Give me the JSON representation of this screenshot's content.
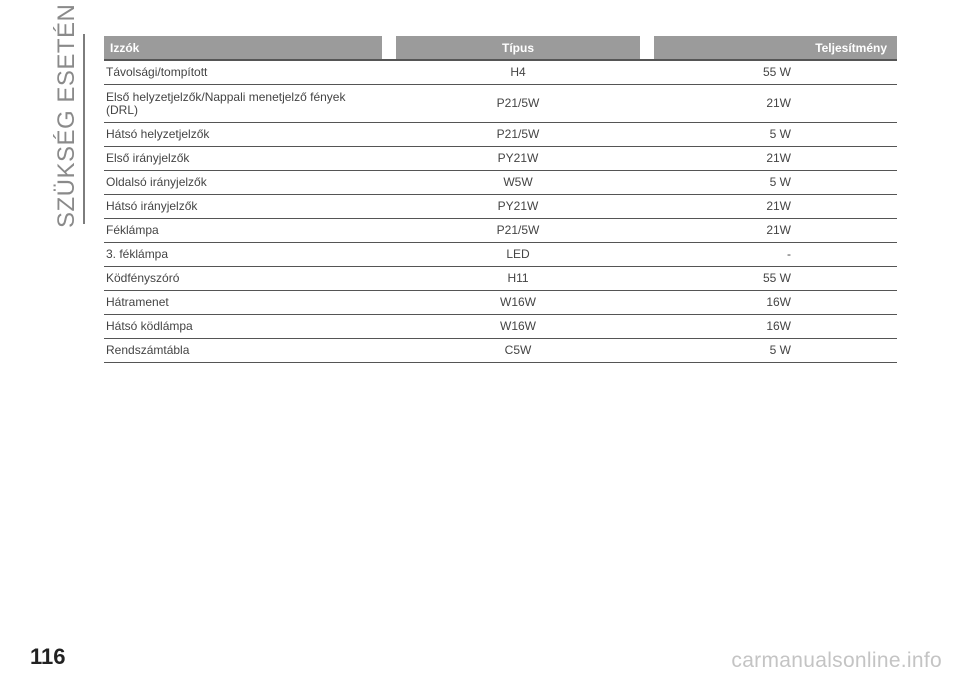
{
  "section": {
    "title": "SZÜKSÉG ESETÉN"
  },
  "table": {
    "headers": {
      "name": "Izzók",
      "type": "Típus",
      "power": "Teljesítmény"
    },
    "rows": [
      {
        "name": "Távolsági/tompított",
        "type": "H4",
        "power": "55 W"
      },
      {
        "name": "Első helyzetjelzők/Nappali menetjelző fények (DRL)",
        "type": "P21/5W",
        "power": "21W"
      },
      {
        "name": "Hátsó helyzetjelzők",
        "type": "P21/5W",
        "power": "5 W"
      },
      {
        "name": "Első irányjelzők",
        "type": "PY21W",
        "power": "21W"
      },
      {
        "name": "Oldalsó irányjelzők",
        "type": "W5W",
        "power": "5 W"
      },
      {
        "name": "Hátsó irányjelzők",
        "type": "PY21W",
        "power": "21W"
      },
      {
        "name": "Féklámpa",
        "type": "P21/5W",
        "power": "21W"
      },
      {
        "name": "3. féklámpa",
        "type": "LED",
        "power": "-"
      },
      {
        "name": "Ködfényszóró",
        "type": "H11",
        "power": "55 W"
      },
      {
        "name": "Hátramenet",
        "type": "W16W",
        "power": "16W"
      },
      {
        "name": "Hátsó ködlámpa",
        "type": "W16W",
        "power": "16W"
      },
      {
        "name": "Rendszámtábla",
        "type": "C5W",
        "power": "5 W"
      }
    ]
  },
  "page": {
    "number": "116"
  },
  "watermark": {
    "text": "carmanualsonline.info"
  }
}
